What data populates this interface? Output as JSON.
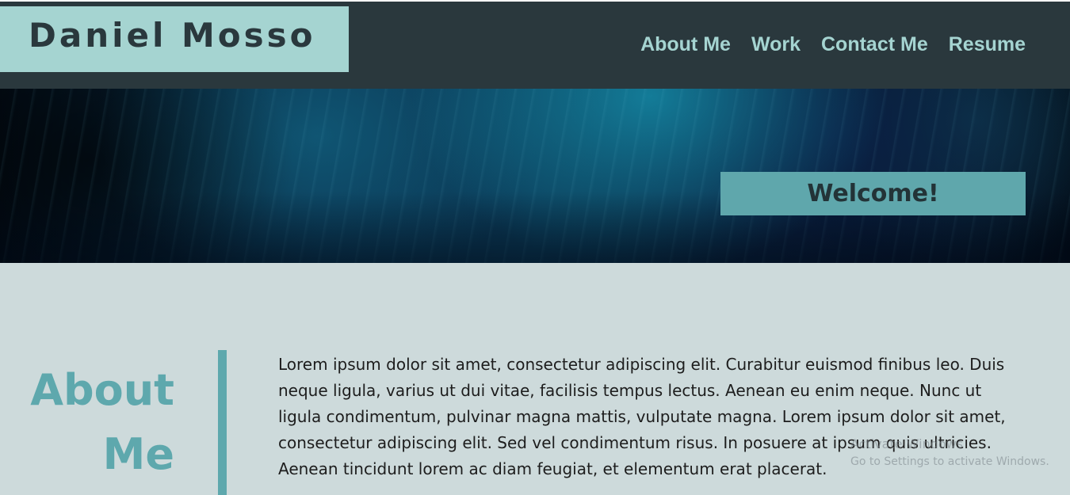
{
  "header": {
    "brand": "Daniel Mosso",
    "nav": [
      {
        "label": "About Me"
      },
      {
        "label": "Work"
      },
      {
        "label": "Contact Me"
      },
      {
        "label": "Resume"
      }
    ]
  },
  "hero": {
    "welcome": "Welcome!"
  },
  "about": {
    "heading": "About Me",
    "text": "Lorem ipsum dolor sit amet, consectetur adipiscing elit. Curabitur euismod finibus leo. Duis neque ligula, varius ut dui vitae, facilisis tempus lectus. Aenean eu enim neque. Nunc ut ligula condimentum, pulvinar magna mattis, vulputate magna. Lorem ipsum dolor sit amet, consectetur adipiscing elit. Sed vel condimentum risus. In posuere at ipsum quis ultricies. Aenean tincidunt lorem ac diam feugiat, et elementum erat placerat."
  },
  "watermark": {
    "title": "Activate Windows",
    "subtitle": "Go to Settings to activate Windows."
  },
  "colors": {
    "header_bg": "#2a383d",
    "brand_bg": "#a5d4d1",
    "nav_text": "#a5d4d1",
    "welcome_bg": "#5fa7ac",
    "page_bg": "#cddadb",
    "accent": "#5ea8ad"
  }
}
